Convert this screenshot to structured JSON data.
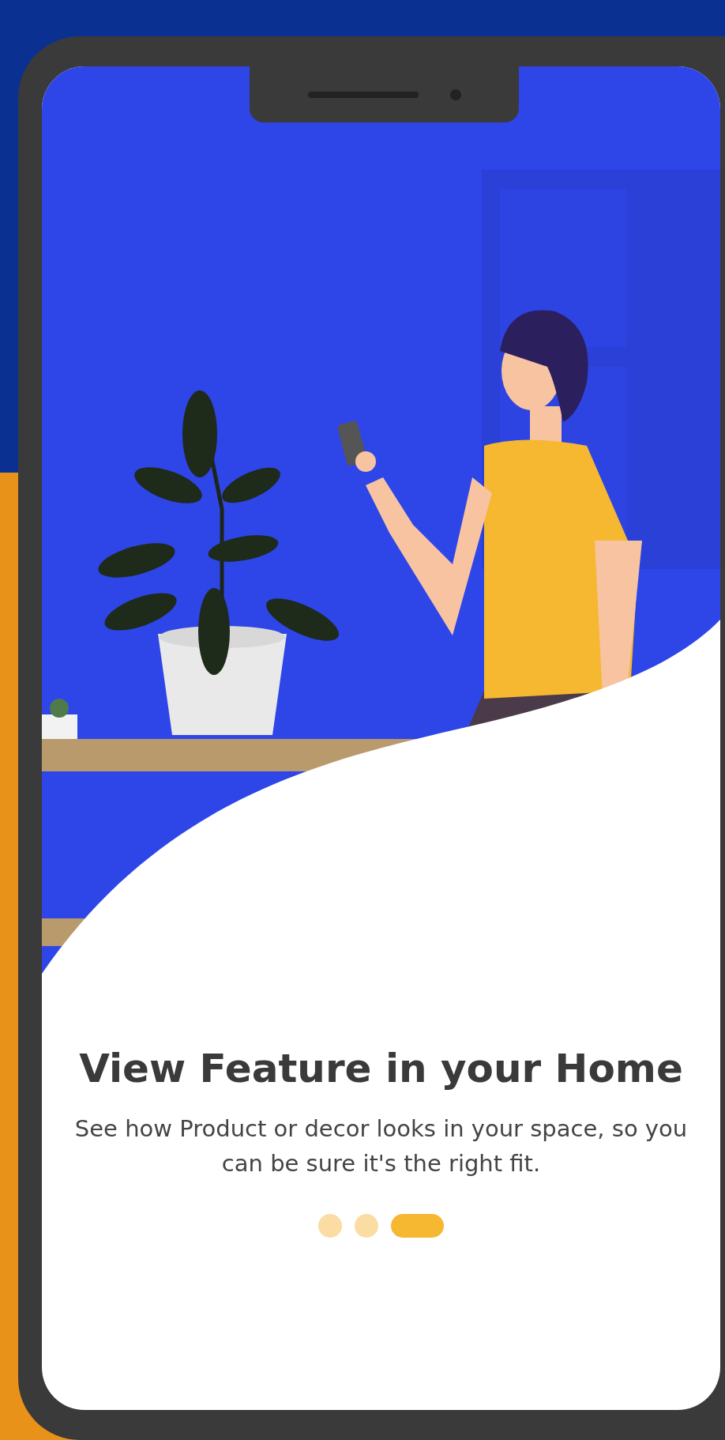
{
  "onboarding": {
    "title": "View Feature in your Home",
    "description": "See how Product or decor looks in your space, so you can be sure it's the right fit.",
    "pager": [
      {
        "selected": false
      },
      {
        "selected": false
      },
      {
        "selected": true
      }
    ]
  }
}
